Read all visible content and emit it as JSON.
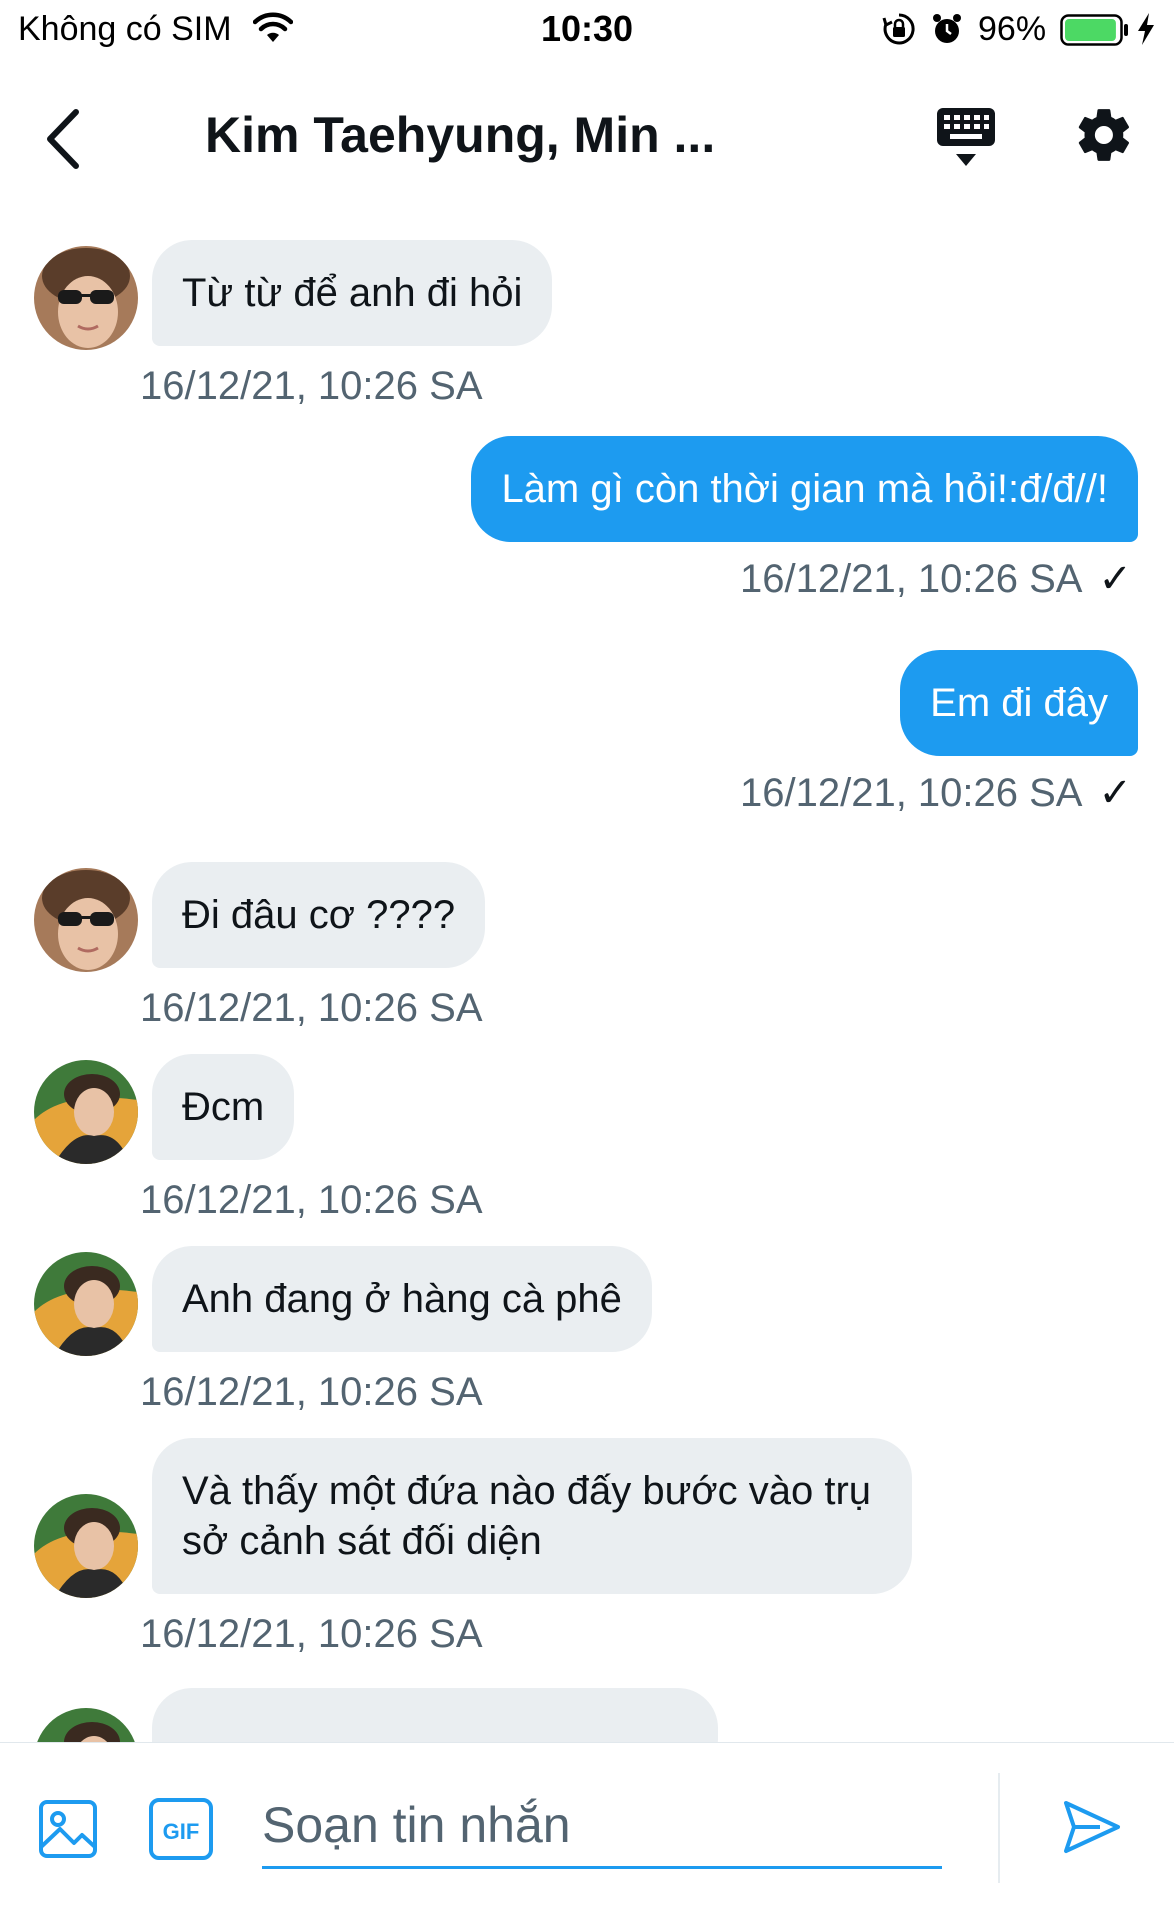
{
  "status_bar": {
    "carrier": "Không có SIM",
    "time": "10:30",
    "battery": "96%",
    "battery_level": 0.96,
    "battery_color": "#4cd964"
  },
  "header": {
    "title": "Kim Taehyung, Min ...",
    "icons": [
      "back-chevron-icon",
      "keyboard-icon",
      "gear-icon"
    ]
  },
  "colors": {
    "accent": "#1d9bf0",
    "incoming_bubble": "#eaeef1",
    "timestamp": "#536471"
  },
  "messages": [
    {
      "direction": "incoming",
      "sender": "avatar-1",
      "text": "Từ từ để anh đi hỏi",
      "timestamp": "16/12/21, 10:26 SA"
    },
    {
      "direction": "outgoing",
      "text": "Làm gì còn thời gian mà hỏi!:đ/đ//!",
      "timestamp": "16/12/21, 10:26 SA",
      "status": "✓"
    },
    {
      "direction": "outgoing",
      "text": "Em đi đây",
      "timestamp": "16/12/21, 10:26 SA",
      "status": "✓"
    },
    {
      "direction": "incoming",
      "sender": "avatar-1",
      "text": "Đi đâu cơ ????",
      "timestamp": "16/12/21, 10:26 SA"
    },
    {
      "direction": "incoming",
      "sender": "avatar-2",
      "text": "Đcm",
      "timestamp": "16/12/21, 10:26 SA"
    },
    {
      "direction": "incoming",
      "sender": "avatar-2",
      "text": "Anh đang ở hàng cà phê",
      "timestamp": "16/12/21, 10:26 SA"
    },
    {
      "direction": "incoming",
      "sender": "avatar-2",
      "text": "Và thấy một đứa nào đấy bước vào trụ sở cảnh sát đối diện",
      "timestamp": "16/12/21, 10:26 SA"
    }
  ],
  "composer": {
    "placeholder": "Soạn tin nhắn",
    "gif_label": "GIF",
    "icons": [
      "image-icon",
      "gif-icon",
      "send-icon"
    ]
  }
}
